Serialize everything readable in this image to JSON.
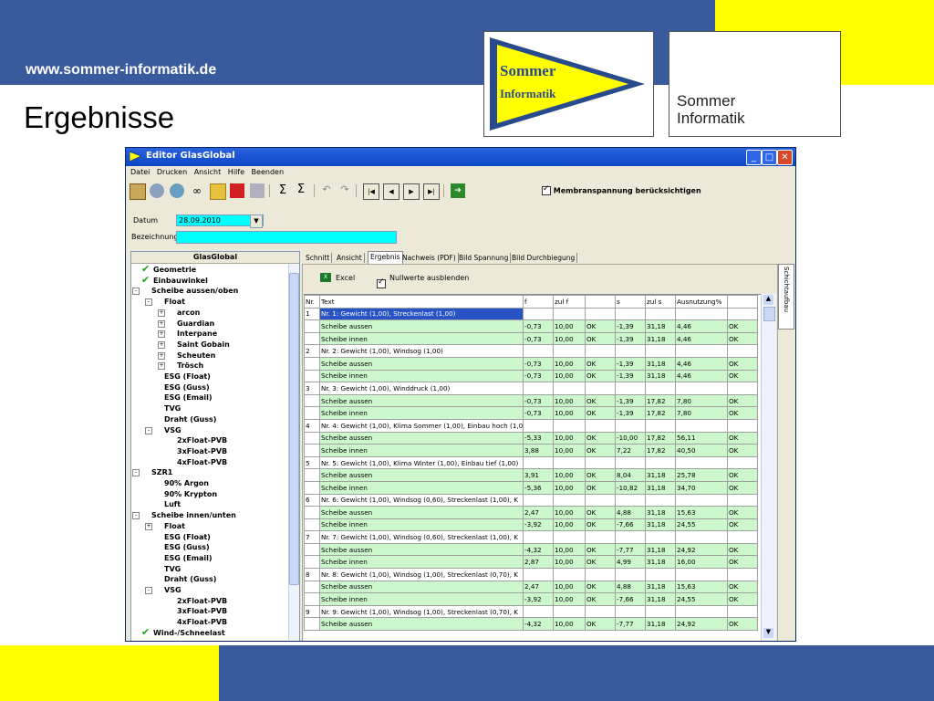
{
  "slide": {
    "url": "www.sommer-informatik.de",
    "title": "Ergebnisse",
    "logo_left": {
      "line1": "Sommer",
      "line2": "Informatik"
    },
    "logo_right": {
      "line1": "Sommer",
      "line2": "Informatik"
    },
    "colors": {
      "blue": "#3a5a9e",
      "yellow": "#ffff00",
      "pennant": "#2a4a8e"
    }
  },
  "window": {
    "title": "Editor GlasGlobal",
    "menu": [
      "Datei",
      "Drucken",
      "Ansicht",
      "Hilfe",
      "Beenden"
    ],
    "membrane_label": "Membranspannung berücksichtigen",
    "date_label": "Datum",
    "date_value": "28.09.2010",
    "name_label": "Bezeichnung",
    "tree_title": "GlasGlobal",
    "side_tab": "Schichtaufbau"
  },
  "tree": [
    {
      "label": "Geometrie",
      "level": 0,
      "tick": true
    },
    {
      "label": "Einbauwinkel",
      "level": 0,
      "tick": true
    },
    {
      "label": "Scheibe aussen/oben",
      "level": 0,
      "exp": "-"
    },
    {
      "label": "Float",
      "level": 1,
      "exp": "-"
    },
    {
      "label": "arcon",
      "level": 2,
      "exp": "+"
    },
    {
      "label": "Guardian",
      "level": 2,
      "exp": "+"
    },
    {
      "label": "Interpane",
      "level": 2,
      "exp": "+"
    },
    {
      "label": "Saint Gobain",
      "level": 2,
      "exp": "+"
    },
    {
      "label": "Scheuten",
      "level": 2,
      "exp": "+"
    },
    {
      "label": "Trösch",
      "level": 2,
      "exp": "+"
    },
    {
      "label": "ESG (Float)",
      "level": 1
    },
    {
      "label": "ESG (Guss)",
      "level": 1
    },
    {
      "label": "ESG (Email)",
      "level": 1
    },
    {
      "label": "TVG",
      "level": 1
    },
    {
      "label": "Draht (Guss)",
      "level": 1
    },
    {
      "label": "VSG",
      "level": 1,
      "exp": "-"
    },
    {
      "label": "2xFloat-PVB",
      "level": 2
    },
    {
      "label": "3xFloat-PVB",
      "level": 2
    },
    {
      "label": "4xFloat-PVB",
      "level": 2
    },
    {
      "label": "SZR1",
      "level": 0,
      "exp": "-"
    },
    {
      "label": "90% Argon",
      "level": 1
    },
    {
      "label": "90% Krypton",
      "level": 1
    },
    {
      "label": "Luft",
      "level": 1
    },
    {
      "label": "Scheibe innen/unten",
      "level": 0,
      "exp": "-"
    },
    {
      "label": "Float",
      "level": 1,
      "exp": "+"
    },
    {
      "label": "ESG (Float)",
      "level": 1
    },
    {
      "label": "ESG (Guss)",
      "level": 1
    },
    {
      "label": "ESG (Email)",
      "level": 1
    },
    {
      "label": "TVG",
      "level": 1
    },
    {
      "label": "Draht (Guss)",
      "level": 1
    },
    {
      "label": "VSG",
      "level": 1,
      "exp": "-"
    },
    {
      "label": "2xFloat-PVB",
      "level": 2
    },
    {
      "label": "3xFloat-PVB",
      "level": 2
    },
    {
      "label": "4xFloat-PVB",
      "level": 2
    },
    {
      "label": "Wind-/Schneelast",
      "level": 0,
      "tick": true
    }
  ],
  "tabs": [
    "Schnitt",
    "Ansicht",
    "Ergebnis",
    "Nachweis (PDF)",
    "Bild Spannung",
    "Bild Durchbiegung"
  ],
  "active_tab": 2,
  "panel": {
    "excel_label": "Excel",
    "null_label": "Nullwerte ausblenden"
  },
  "table": {
    "headers": [
      "Nr.",
      "Text",
      "f",
      "zul f",
      "",
      "s",
      "zul s",
      "Ausnutzung%",
      ""
    ],
    "rows": [
      {
        "nr": "1",
        "text": "Nr. 1:  Gewicht (1,00), Streckenlast (1,00)",
        "sel": true
      },
      {
        "text": "Scheibe aussen",
        "v": [
          "-0,73",
          "10,00",
          "OK",
          "-1,39",
          "31,18",
          "4,46",
          "OK"
        ]
      },
      {
        "text": "Scheibe innen",
        "v": [
          "-0,73",
          "10,00",
          "OK",
          "-1,39",
          "31,18",
          "4,46",
          "OK"
        ]
      },
      {
        "nr": "2",
        "text": "Nr. 2:  Gewicht (1,00), Windsog (1,00)"
      },
      {
        "text": "Scheibe aussen",
        "v": [
          "-0,73",
          "10,00",
          "OK",
          "-1,39",
          "31,18",
          "4,46",
          "OK"
        ]
      },
      {
        "text": "Scheibe innen",
        "v": [
          "-0,73",
          "10,00",
          "OK",
          "-1,39",
          "31,18",
          "4,46",
          "OK"
        ]
      },
      {
        "nr": "3",
        "text": "Nr. 3:  Gewicht (1,00), Winddruck (1,00)"
      },
      {
        "text": "Scheibe aussen",
        "v": [
          "-0,73",
          "10,00",
          "OK",
          "-1,39",
          "17,82",
          "7,80",
          "OK"
        ]
      },
      {
        "text": "Scheibe innen",
        "v": [
          "-0,73",
          "10,00",
          "OK",
          "-1,39",
          "17,82",
          "7,80",
          "OK"
        ]
      },
      {
        "nr": "4",
        "text": "Nr. 4:  Gewicht (1,00), Klima Sommer (1,00), Einbau hoch (1,0"
      },
      {
        "text": "Scheibe aussen",
        "v": [
          "-5,33",
          "10,00",
          "OK",
          "-10,00",
          "17,82",
          "56,11",
          "OK"
        ]
      },
      {
        "text": "Scheibe innen",
        "v": [
          "3,88",
          "10,00",
          "OK",
          "7,22",
          "17,82",
          "40,50",
          "OK"
        ]
      },
      {
        "nr": "5",
        "text": "Nr. 5:  Gewicht (1,00), Klima Winter (1,00), Einbau tief (1,00)"
      },
      {
        "text": "Scheibe aussen",
        "v": [
          "3,91",
          "10,00",
          "OK",
          "8,04",
          "31,18",
          "25,78",
          "OK"
        ]
      },
      {
        "text": "Scheibe innen",
        "v": [
          "-5,36",
          "10,00",
          "OK",
          "-10,82",
          "31,18",
          "34,70",
          "OK"
        ]
      },
      {
        "nr": "6",
        "text": "Nr. 6:  Gewicht (1,00), Windsog (0,60), Streckenlast (1,00), K"
      },
      {
        "text": "Scheibe aussen",
        "v": [
          "2,47",
          "10,00",
          "OK",
          "4,88",
          "31,18",
          "15,63",
          "OK"
        ]
      },
      {
        "text": "Scheibe innen",
        "v": [
          "-3,92",
          "10,00",
          "OK",
          "-7,66",
          "31,18",
          "24,55",
          "OK"
        ]
      },
      {
        "nr": "7",
        "text": "Nr. 7:  Gewicht (1,00), Windsog (0,60), Streckenlast (1,00), K"
      },
      {
        "text": "Scheibe aussen",
        "v": [
          "-4,32",
          "10,00",
          "OK",
          "-7,77",
          "31,18",
          "24,92",
          "OK"
        ]
      },
      {
        "text": "Scheibe innen",
        "v": [
          "2,87",
          "10,00",
          "OK",
          "4,99",
          "31,18",
          "16,00",
          "OK"
        ]
      },
      {
        "nr": "8",
        "text": "Nr. 8:  Gewicht (1,00), Windsog (1,00), Streckenlast (0,70), K"
      },
      {
        "text": "Scheibe aussen",
        "v": [
          "2,47",
          "10,00",
          "OK",
          "4,88",
          "31,18",
          "15,63",
          "OK"
        ]
      },
      {
        "text": "Scheibe innen",
        "v": [
          "-3,92",
          "10,00",
          "OK",
          "-7,66",
          "31,18",
          "24,55",
          "OK"
        ]
      },
      {
        "nr": "9",
        "text": "Nr. 9:  Gewicht (1,00), Windsog (1,00), Streckenlast (0,70), K"
      },
      {
        "text": "Scheibe aussen",
        "v": [
          "-4,32",
          "10,00",
          "OK",
          "-7,77",
          "31,18",
          "24,92",
          "OK"
        ]
      }
    ]
  }
}
